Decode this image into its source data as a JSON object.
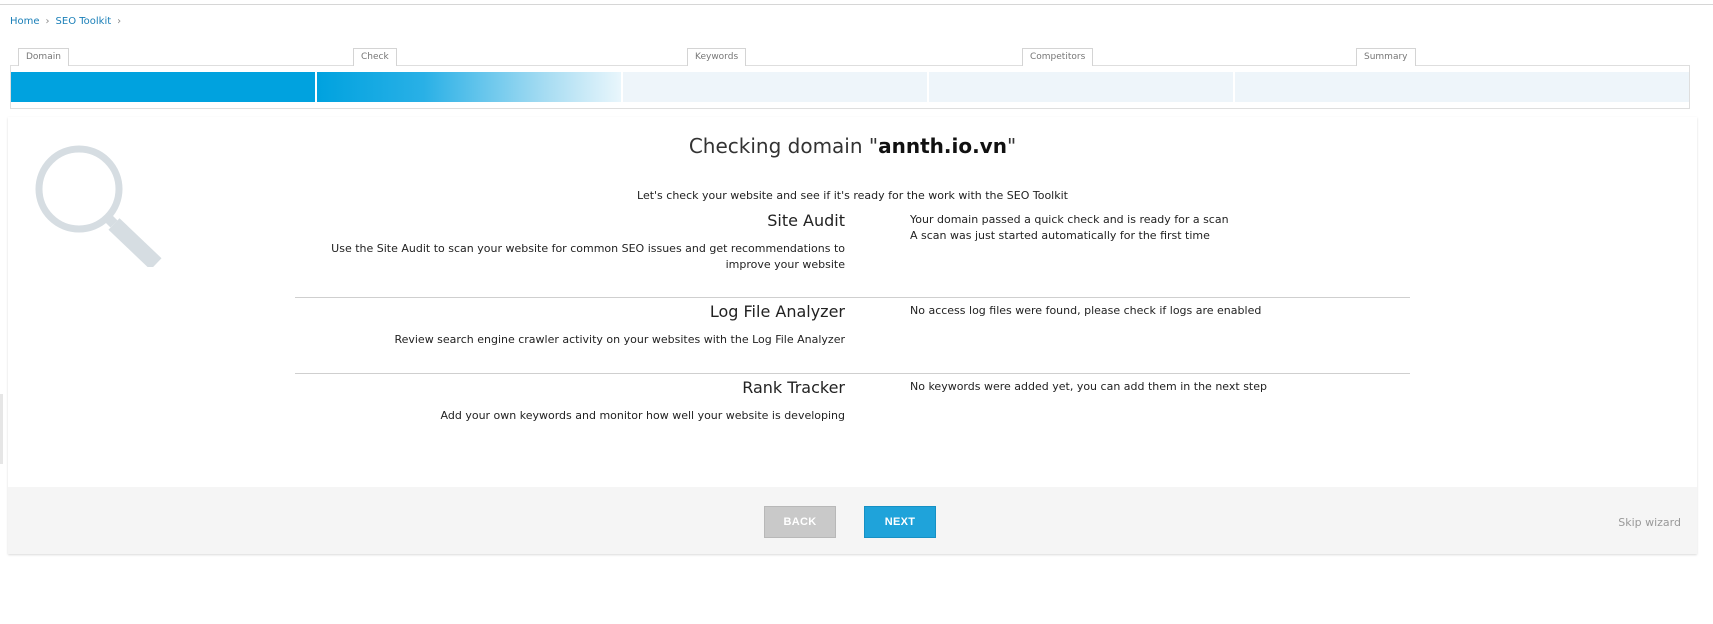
{
  "breadcrumb": {
    "home": "Home",
    "section": "SEO Toolkit",
    "separator": "›"
  },
  "wizard_steps": [
    {
      "label": "Domain",
      "state": "done"
    },
    {
      "label": "Check",
      "state": "active"
    },
    {
      "label": "Keywords",
      "state": "pending"
    },
    {
      "label": "Competitors",
      "state": "pending"
    },
    {
      "label": "Summary",
      "state": "pending"
    }
  ],
  "colors": {
    "accent": "#00a2df",
    "button_next": "#1fa3da",
    "button_back": "#c9c9c9",
    "link": "#1a7fb8"
  },
  "main": {
    "title_prefix": "Checking domain \"",
    "domain": "annth.io.vn",
    "title_suffix": "\"",
    "subtitle": "Let's check your website and see if it's ready for the work with the SEO Toolkit",
    "icon": "magnifier-icon"
  },
  "tools": [
    {
      "name": "Site Audit",
      "description": "Use the Site Audit to scan your website for common SEO issues and get recommendations to improve your website",
      "status_line1": "Your domain passed a quick check and is ready for a scan",
      "status_line2": "A scan was just started automatically for the first time"
    },
    {
      "name": "Log File Analyzer",
      "description": "Review search engine crawler activity on your websites with the Log File Analyzer",
      "status_line1": "No access log files were found, please check if logs are enabled",
      "status_line2": ""
    },
    {
      "name": "Rank Tracker",
      "description": "Add your own keywords and monitor how well your website is developing",
      "status_line1": "No keywords were added yet, you can add them in the next step",
      "status_line2": ""
    }
  ],
  "footer": {
    "back_label": "BACK",
    "next_label": "NEXT",
    "skip_label": "Skip wizard"
  }
}
